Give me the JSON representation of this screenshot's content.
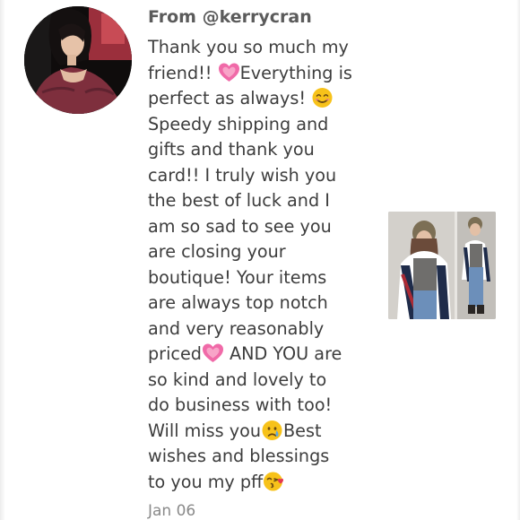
{
  "review": {
    "sender": "From @kerrycran",
    "message_lines": [
      {
        "parts": [
          {
            "text": "Thank you so much my"
          }
        ]
      },
      {
        "parts": [
          {
            "text": "friend!! "
          },
          {
            "emoji": "growing-heart-emoji"
          },
          {
            "text": "Everything is"
          }
        ]
      },
      {
        "parts": [
          {
            "text": "perfect as always! "
          },
          {
            "emoji": "smiling-face-emoji"
          }
        ]
      },
      {
        "parts": [
          {
            "text": "Speedy shipping and"
          }
        ]
      },
      {
        "parts": [
          {
            "text": "gifts and thank you"
          }
        ]
      },
      {
        "parts": [
          {
            "text": "card!! I truly wish you"
          }
        ]
      },
      {
        "parts": [
          {
            "text": "the best of luck and I"
          }
        ]
      },
      {
        "parts": [
          {
            "text": "am so sad to see you"
          }
        ]
      },
      {
        "parts": [
          {
            "text": "are closing your"
          }
        ]
      },
      {
        "parts": [
          {
            "text": "boutique! Your items"
          }
        ]
      },
      {
        "parts": [
          {
            "text": "are always top notch"
          }
        ]
      },
      {
        "parts": [
          {
            "text": "and very reasonably"
          }
        ]
      },
      {
        "parts": [
          {
            "text": "priced"
          },
          {
            "emoji": "growing-heart-emoji"
          },
          {
            "text": " AND YOU are"
          }
        ]
      },
      {
        "parts": [
          {
            "text": "so kind and lovely to"
          }
        ]
      },
      {
        "parts": [
          {
            "text": "do business with too!"
          }
        ]
      },
      {
        "parts": [
          {
            "text": "Will miss you"
          },
          {
            "emoji": "crying-face-emoji"
          },
          {
            "text": "Best"
          }
        ]
      },
      {
        "parts": [
          {
            "text": "wishes and blessings"
          }
        ]
      },
      {
        "parts": [
          {
            "text": "to you my pff"
          },
          {
            "emoji": "face-blowing-kiss-emoji"
          }
        ]
      }
    ],
    "date": "Jan 06"
  },
  "colors": {
    "sender_text": "#5b5b5b",
    "message_text": "#3d3d3d",
    "date_text": "#8a8a8a",
    "heart_pink": "#f06aa8",
    "emoji_yellow": "#f7c21a"
  },
  "icons": {
    "avatar": "user-avatar-photo",
    "listing_photo": "listing-thumbnail-photo"
  }
}
